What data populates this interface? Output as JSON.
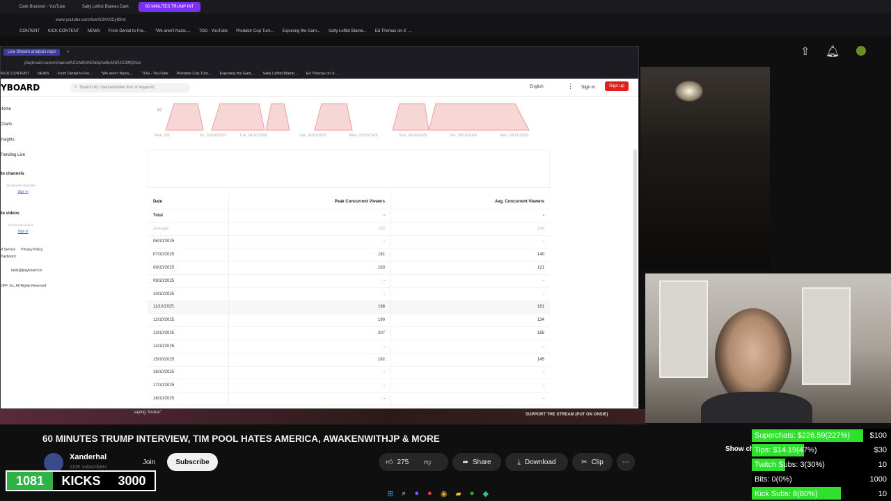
{
  "outer_browser": {
    "tabs": [
      "Dark Brandon - YouTube",
      "Salty Leftist Blames Dark",
      "60 MINUTES TRUMP INT"
    ],
    "url": "www.youtube.com/live/G9XA3Cy89nk",
    "bookmarks": [
      "CONTENT",
      "KICK CONTENT",
      "NEWS",
      "From Denial to Fre...",
      "\"We aren't Nazis,...",
      "TOG - YouTube",
      "Predator Cop Turn...",
      "Exposing the Gam...",
      "Salty Leftist Blame...",
      "Ed Thomas on X: ..."
    ]
  },
  "inner_browser": {
    "tab": "Live Stream analysis repo",
    "url": "playboard.co/en/channel/UCcWkShE9dqAw8uM1RJC99fQ/live",
    "bookmarks": [
      "KICK CONTENT",
      "NEWS",
      "From Denial to Fre...",
      "\"We aren't Nazis,...",
      "TOG - YouTube",
      "Predator Cop Turn...",
      "Exposing the Gam...",
      "Salty Leftist Blame...",
      "Ed Thomas on X: ..."
    ]
  },
  "site": {
    "logo": "YBOARD",
    "search_placeholder": "Search by channel/video link or keyword",
    "language": "English",
    "sign_in": "Sign in",
    "sign_up": "Sign up",
    "sidebar": {
      "items": [
        "Home",
        "Charts",
        "Insights",
        "Trending Live"
      ],
      "fav_channels": "ite channels",
      "fav_videos": "ite videos",
      "no_fav": "No favorite channels",
      "no_fav_videos": "No favorite videos",
      "sign_in": "Sign in",
      "terms": "of Service",
      "privacy": "Privacy Policy",
      "playboard": "Playboard",
      "email": "hello@playboard.co",
      "copyright": "DIFF, Inc. All Rights Reserved"
    }
  },
  "chart_data": {
    "type": "area",
    "ytick": "60",
    "x_ticks": [
      "Mon, 06/...",
      "Fri, 10/10/2025",
      "Tue, 14/10/2025",
      "Sat, 18/10/2025",
      "Wed, 22/10/2025",
      "Sun, 26/10/2025",
      "Thu, 30/10/2025",
      "Mon, 03/11/2025"
    ]
  },
  "table": {
    "headers": [
      "Date",
      "Peak Concurrent Viewers",
      "Avg. Concurrent Viewers"
    ],
    "total_label": "Total",
    "total_peak": "-",
    "total_avg": "-",
    "average_label": "Average",
    "average_peak": "185",
    "average_avg": "146",
    "rows": [
      {
        "date": "06/10/2025",
        "peak": "-",
        "avg": "-"
      },
      {
        "date": "07/10/2025",
        "peak": "181",
        "avg": "140"
      },
      {
        "date": "08/10/2025",
        "peak": "183",
        "avg": "121"
      },
      {
        "date": "09/10/2025",
        "peak": "-",
        "avg": "-"
      },
      {
        "date": "10/10/2025",
        "peak": "-",
        "avg": "-"
      },
      {
        "date": "11/10/2025",
        "peak": "198",
        "avg": "161"
      },
      {
        "date": "12/10/2025",
        "peak": "190",
        "avg": "134"
      },
      {
        "date": "13/10/2025",
        "peak": "207",
        "avg": "185"
      },
      {
        "date": "14/10/2025",
        "peak": "-",
        "avg": "-"
      },
      {
        "date": "15/10/2025",
        "peak": "182",
        "avg": "145"
      },
      {
        "date": "16/10/2025",
        "peak": "-",
        "avg": "-"
      },
      {
        "date": "17/10/2025",
        "peak": "-",
        "avg": "-"
      },
      {
        "date": "18/10/2025",
        "peak": "-",
        "avg": "-"
      }
    ]
  },
  "stream": {
    "caption": "saying \"broker\"",
    "support_banner": "SUPPORT THE STREAM (PUT ON ONSIE)",
    "title": "60 MINUTES TRUMP INTERVIEW, TIM POOL HATES AMERICA, AWAKENWITHJP & MORE",
    "channel": "Xanderhal",
    "subs": "110K subscribers",
    "join": "Join",
    "subscribe": "Subscribe",
    "likes": "275",
    "share": "Share",
    "download": "Download",
    "clip": "Clip",
    "show_chat": "Show ch"
  },
  "kicks": {
    "count": "1081",
    "label": "KICKS",
    "goal": "3000"
  },
  "goals": [
    {
      "label": "Superchats:",
      "value": "$226.59(227%)",
      "target": "$100",
      "fill": 1.0
    },
    {
      "label": "Tips:",
      "value": "$14.19(47%)",
      "target": "$30",
      "fill": 0.47
    },
    {
      "label": "Twitch Subs:",
      "value": "3(30%)",
      "target": "10",
      "fill": 0.3
    },
    {
      "label": "Bits:",
      "value": "0(0%)",
      "target": "1000",
      "fill": 0.0
    },
    {
      "label": "Kick Subs:",
      "value": "8(80%)",
      "target": "10",
      "fill": 0.8
    }
  ]
}
